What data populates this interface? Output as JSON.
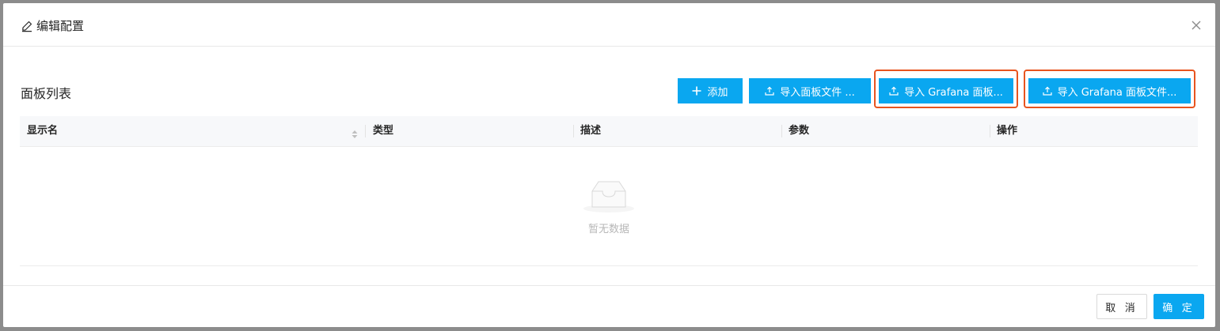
{
  "dialog": {
    "title": "编辑配置",
    "title_icon": "edit-pen-icon",
    "close_icon": "close-icon"
  },
  "panel_section": {
    "title": "面板列表",
    "buttons": {
      "add": {
        "label": "添加",
        "icon": "plus-icon"
      },
      "import_panel_file": {
        "label": "导入面板文件 ...",
        "icon": "upload-icon"
      },
      "import_grafana_panel": {
        "label": "导入 Grafana 面板...",
        "icon": "upload-icon"
      },
      "import_grafana_panel_file": {
        "label": "导入 Grafana 面板文件...",
        "icon": "upload-icon"
      }
    },
    "table": {
      "columns": [
        {
          "label": "显示名",
          "sortable": true
        },
        {
          "label": "类型"
        },
        {
          "label": "描述"
        },
        {
          "label": "参数"
        },
        {
          "label": "操作"
        }
      ],
      "rows": [],
      "empty_text": "暂无数据",
      "empty_icon": "empty-inbox-icon"
    }
  },
  "footer": {
    "cancel_label": "取 消",
    "ok_label": "确 定"
  },
  "colors": {
    "primary": "#0aa7f0",
    "highlight_border": "#e8541f",
    "backdrop": "#8c8c8c"
  }
}
